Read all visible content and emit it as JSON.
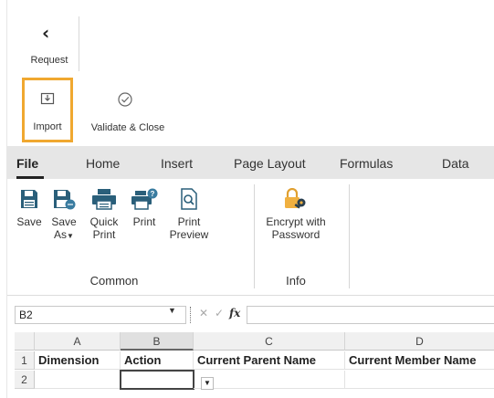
{
  "panel": {
    "back_label": "Request",
    "back_icon": "chevron-left-icon",
    "import_label": "Import",
    "import_icon": "import-icon",
    "validate_label": "Validate & Close",
    "validate_icon": "check-circle-icon",
    "highlight_color": "#f0a830"
  },
  "ribbon": {
    "tabs": [
      {
        "label": "File",
        "active": true
      },
      {
        "label": "Home"
      },
      {
        "label": "Insert"
      },
      {
        "label": "Page Layout"
      },
      {
        "label": "Formulas"
      },
      {
        "label": "Data"
      }
    ],
    "common": {
      "group_label": "Common",
      "buttons": [
        {
          "label": "Save",
          "icon": "save-icon"
        },
        {
          "label": "Save",
          "label2": "As",
          "icon": "save-as-icon"
        },
        {
          "label": "Quick",
          "label2": "Print",
          "icon": "quick-print-icon"
        },
        {
          "label": "Print",
          "icon": "print-icon"
        },
        {
          "label": "Print",
          "label2": "Preview",
          "icon": "print-preview-icon"
        }
      ]
    },
    "info": {
      "group_label": "Info",
      "buttons": [
        {
          "label": "Encrypt with",
          "label2": "Password",
          "icon": "lock-key-icon"
        }
      ]
    }
  },
  "formula_bar": {
    "name_box": "B2",
    "fx": "fx",
    "value": ""
  },
  "grid": {
    "columns": [
      "A",
      "B",
      "C",
      "D"
    ],
    "rows": [
      "1",
      "2"
    ],
    "row1": [
      "Dimension",
      "Action",
      "Current Parent Name",
      "Current Member Name"
    ],
    "selected_cell": "B2"
  }
}
